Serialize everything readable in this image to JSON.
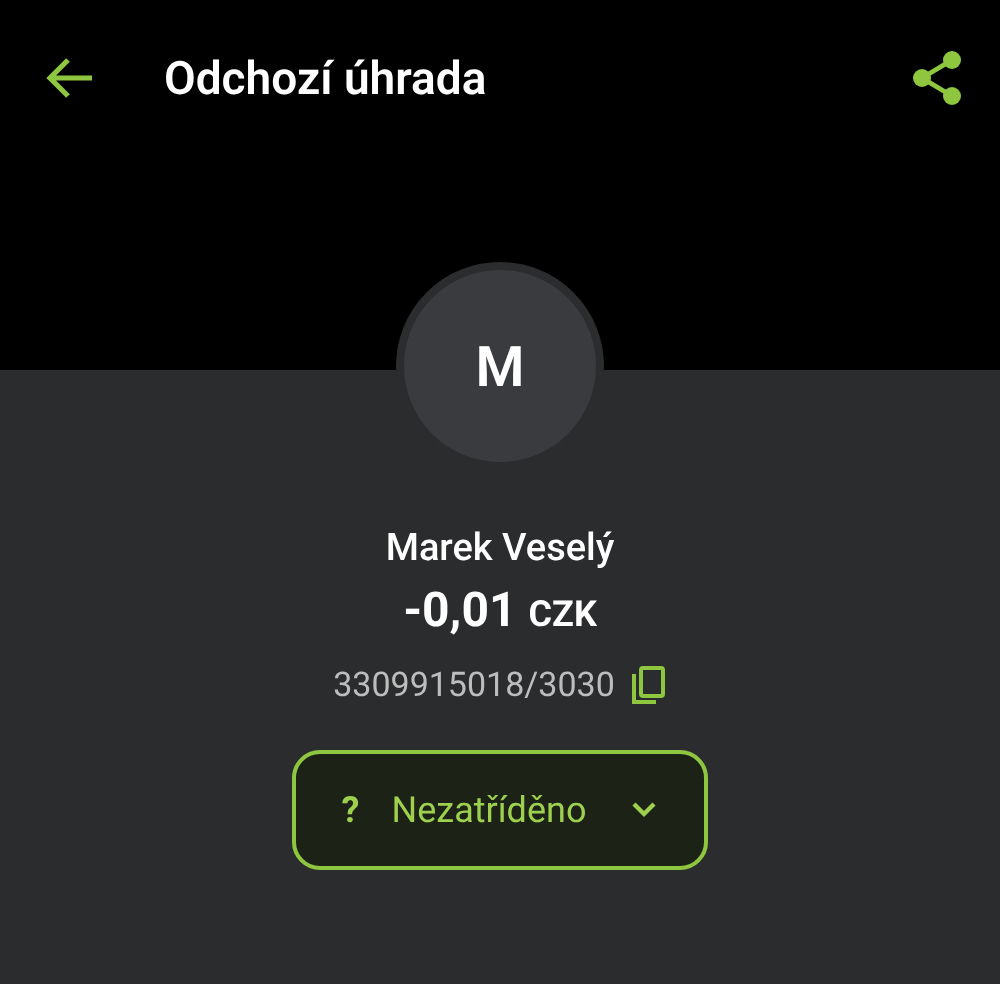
{
  "app_bar": {
    "title": "Odchozí úhrada"
  },
  "counterparty": {
    "initial": "M",
    "name": "Marek Veselý",
    "amount": "-0,01",
    "currency": "CZK",
    "account": "3309915018/3030"
  },
  "category": {
    "icon": "?",
    "label": "Nezatříděno"
  }
}
